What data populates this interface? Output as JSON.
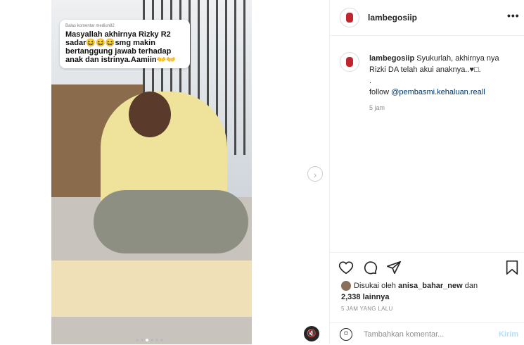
{
  "media": {
    "caption_meta": "Balas komentar mediun82",
    "caption_text": "Masyallah akhirnya Rizky R2 sadar😆😆😆smg makin bertanggung jawab terhadap anak dan istrinya.Aamiin👐👐",
    "mute_icon": "🔇",
    "next_icon": "›"
  },
  "post": {
    "username": "lambegosiip",
    "more_icon": "•••",
    "comment_username": "lambegosiip",
    "comment_text": " Syukurlah, akhirnya nya Rizki DA telah akui anaknya..♥□.",
    "comment_dot": ".",
    "follow_label": "follow ",
    "follow_link": "@pembasmi.kehaluan.reall",
    "time": "5 jam",
    "liked_by_prefix": "Disukai oleh ",
    "liked_by_user": "anisa_bahar_new",
    "liked_by_and": " dan",
    "likes_count": "2,338 lainnya",
    "posted_ago": "5 JAM YANG LALU",
    "add_comment_placeholder": "Tambahkan komentar...",
    "send_label": "Kirim"
  },
  "colors": {
    "link": "#00376b",
    "send_disabled": "#b2dffc",
    "brand_red": "#c0242c"
  }
}
